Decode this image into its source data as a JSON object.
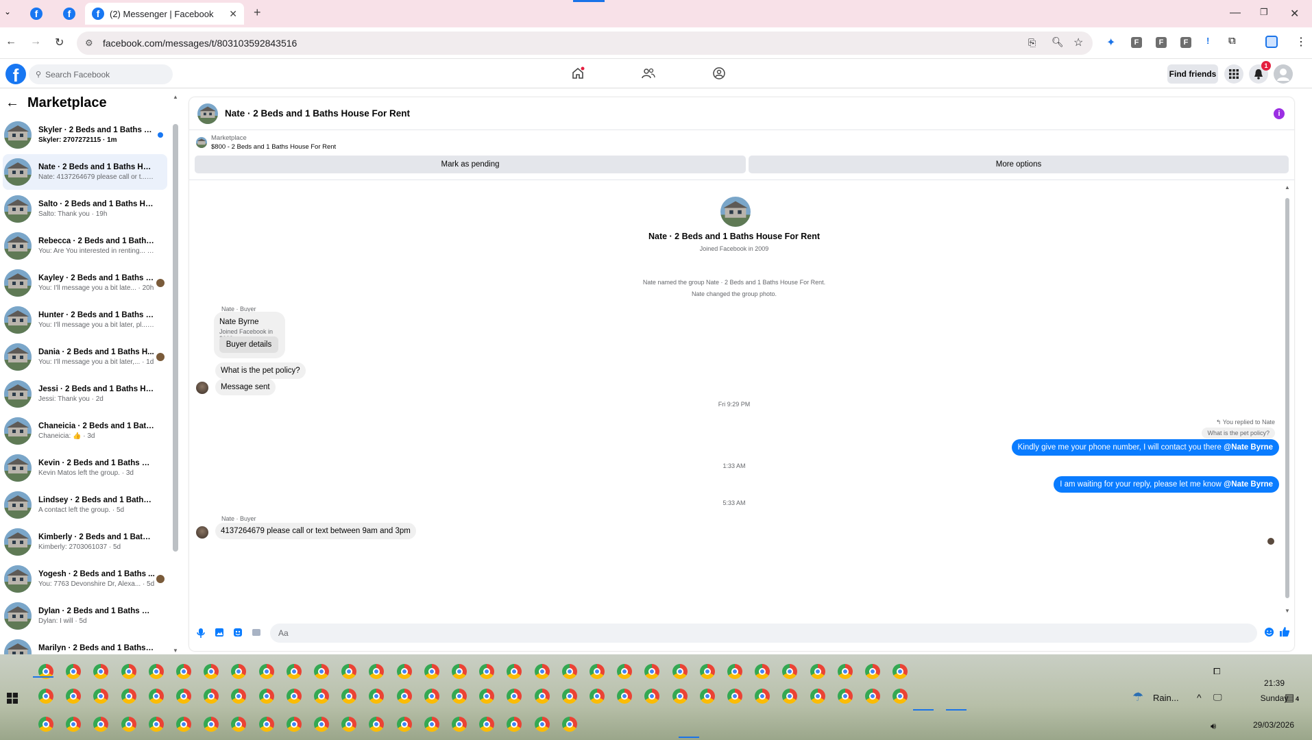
{
  "browser": {
    "active_tab_title": "(2) Messenger | Facebook",
    "url": "facebook.com/messages/t/803103592843516",
    "extension_letters": [
      "F",
      "F",
      "F"
    ]
  },
  "fb_header": {
    "search_placeholder": "Search Facebook",
    "find_friends_label": "Find friends",
    "notification_count": "1"
  },
  "sidebar": {
    "title": "Marketplace",
    "conversations": [
      {
        "name": "Skyler · 2 Beds and 1 Baths Ho...",
        "preview": "Skyler: 2707272115 · 1m"
      },
      {
        "name": "Nate · 2 Beds and 1 Baths Hous...",
        "preview": "Nate: 4137264679 please call or t... · 16h"
      },
      {
        "name": "Salto · 2 Beds and 1 Baths Hous...",
        "preview": "Salto: Thank you · 19h"
      },
      {
        "name": "Rebecca · 2 Beds and 1 Baths H...",
        "preview": "You: Are You interested in renting... · 20h"
      },
      {
        "name": "Kayley · 2 Beds and 1 Baths H...",
        "preview": "You: I'll message you a bit late... · 20h"
      },
      {
        "name": "Hunter · 2 Beds and 1 Baths Ho...",
        "preview": "You: I'll message you a bit later, pl... · 1d"
      },
      {
        "name": "Dania · 2 Beds and 1 Baths H...",
        "preview": "You: I'll message you a bit later,... · 1d"
      },
      {
        "name": "Jessi · 2 Beds and 1 Baths Hous...",
        "preview": "Jessi: Thank you · 2d"
      },
      {
        "name": "Chaneicia · 2 Beds and 1 Baths ...",
        "preview": "Chaneicia: 👍 · 3d"
      },
      {
        "name": "Kevin · 2 Beds and 1 Baths Hous...",
        "preview": "Kevin Matos left the group. · 3d"
      },
      {
        "name": "Lindsey · 2 Beds and 1 Baths Ho...",
        "preview": "A contact left the group. · 5d"
      },
      {
        "name": "Kimberly · 2 Beds and 1 Baths H...",
        "preview": "Kimberly: 2703061037 · 5d"
      },
      {
        "name": "Yogesh · 2 Beds and 1 Baths ...",
        "preview": "You: 7763 Devonshire Dr, Alexa... · 5d"
      },
      {
        "name": "Dylan · 2 Beds and 1 Baths Hou...",
        "preview": "Dylan: I will · 5d"
      },
      {
        "name": "Marilyn · 2 Beds and 1 Baths Ho...",
        "preview": "Marilyn: Marilyn is in a rental now... · 6d"
      }
    ]
  },
  "chat": {
    "title": "Nate · 2 Beds and 1 Baths House For Rent",
    "listing_label": "Marketplace",
    "listing_text": "$800 - 2 Beds and 1 Baths House For Rent",
    "mark_pending": "Mark as pending",
    "more_options": "More options",
    "intro_title": "Nate · 2 Beds and 1 Baths House For Rent",
    "intro_sub": "Joined Facebook in 2009",
    "sys1": "Nate named the group Nate · 2 Beds and 1 Baths House For Rent.",
    "sys2": "Nate changed the group photo.",
    "sender_label": "Nate · Buyer",
    "buyer_name": "Nate Byrne",
    "buyer_joined": "Joined Facebook in 2009",
    "buyer_details": "Buyer details",
    "msg_pet": "What is the pet policy?",
    "msg_sent": "Message sent",
    "time1": "Fri 9:29 PM",
    "replied_to": "You replied to Nate",
    "quoted": "What is the pet policy?",
    "out1_text": "Kindly give me your phone number, I will contact you there ",
    "out1_mention": "@Nate Byrne",
    "time2": "1:33 AM",
    "out2_text": "I am waiting for your reply, please let me know ",
    "out2_mention": "@Nate Byrne",
    "time3": "5:33 AM",
    "sender_label2": "Nate · Buyer",
    "msg_last": "4137264679 please call or text between 9am and 3pm",
    "composer_placeholder": "Aa"
  },
  "taskbar": {
    "weather": "Rain...",
    "time": "21:39",
    "day": "Sunday",
    "date": "29/03/2026",
    "notif_count": "4"
  },
  "colors": {
    "brand": "#1877f2",
    "outgoing": "#0a7cff",
    "tabbar": "#f8e1e8"
  }
}
